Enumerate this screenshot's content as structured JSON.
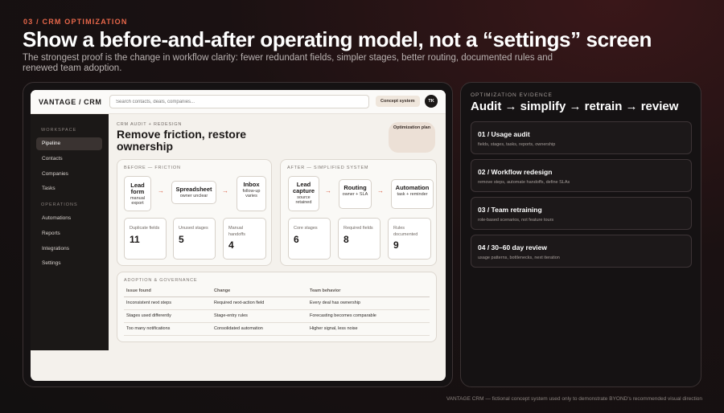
{
  "slide": {
    "eyebrow": "03 / CRM OPTIMIZATION",
    "title": "Show a before-and-after operating model, not a “settings” screen",
    "subtitle": "The strongest proof is the change in workflow clarity: fewer redundant fields, simpler stages, better routing, documented rules and renewed team adoption.",
    "footer": "VANTAGE CRM — fictional concept system used only to demonstrate BYOND's recommended visual direction"
  },
  "app": {
    "brand": "VANTAGE / CRM",
    "search_placeholder": "Search contacts, deals, companies...",
    "concept_button": "Concept system",
    "avatar_initials": "TK"
  },
  "sidebar": {
    "workspace_label": "WORKSPACE",
    "operations_label": "OPERATIONS",
    "workspace_items": [
      "Pipeline",
      "Contacts",
      "Companies",
      "Tasks"
    ],
    "operations_items": [
      "Automations",
      "Reports",
      "Integrations",
      "Settings"
    ],
    "active_item": "Pipeline"
  },
  "main": {
    "eyebrow": "CRM AUDIT + REDESIGN",
    "title": "Remove friction, restore ownership",
    "plan_badge": "Optimization plan"
  },
  "before": {
    "label": "BEFORE — FRICTION",
    "nodes": [
      {
        "title": "Lead form",
        "sub": "manual export"
      },
      {
        "title": "Spreadsheet",
        "sub": "owner unclear"
      },
      {
        "title": "Inbox",
        "sub": "follow-up varies"
      }
    ],
    "metrics": [
      {
        "label": "Duplicate fields",
        "value": "11"
      },
      {
        "label": "Unused stages",
        "value": "5"
      },
      {
        "label": "Manual handoffs",
        "value": "4"
      }
    ]
  },
  "after": {
    "label": "AFTER — SIMPLIFIED SYSTEM",
    "nodes": [
      {
        "title": "Lead capture",
        "sub": "source retained"
      },
      {
        "title": "Routing",
        "sub": "owner + SLA"
      },
      {
        "title": "Automation",
        "sub": "task + reminder"
      }
    ],
    "metrics": [
      {
        "label": "Core stages",
        "value": "6"
      },
      {
        "label": "Required fields",
        "value": "8"
      },
      {
        "label": "Rules documented",
        "value": "9"
      }
    ]
  },
  "governance": {
    "label": "ADOPTION & GOVERNANCE",
    "columns": [
      "Issue found",
      "Change",
      "Team behavior"
    ],
    "rows": [
      [
        "Inconsistent next steps",
        "Required next-action field",
        "Every deal has ownership"
      ],
      [
        "Stages used differently",
        "Stage-entry rules",
        "Forecasting becomes comparable"
      ],
      [
        "Too many notifications",
        "Consolidated automation",
        "Higher signal, less noise"
      ]
    ]
  },
  "evidence": {
    "eyebrow": "OPTIMIZATION EVIDENCE",
    "title": "Audit → simplify → retrain → review",
    "cards": [
      {
        "title": "01 / Usage audit",
        "desc": "fields, stages, tasks, reports, ownership"
      },
      {
        "title": "02 / Workflow redesign",
        "desc": "remove steps, automate handoffs, define SLAs"
      },
      {
        "title": "03 / Team retraining",
        "desc": "role-based scenarios, not feature tours"
      },
      {
        "title": "04 / 30–60 day review",
        "desc": "usage patterns, bottlenecks, next iteration"
      }
    ]
  },
  "colors": {
    "accent": "#e8674a",
    "arrow": "#d95c3f"
  }
}
